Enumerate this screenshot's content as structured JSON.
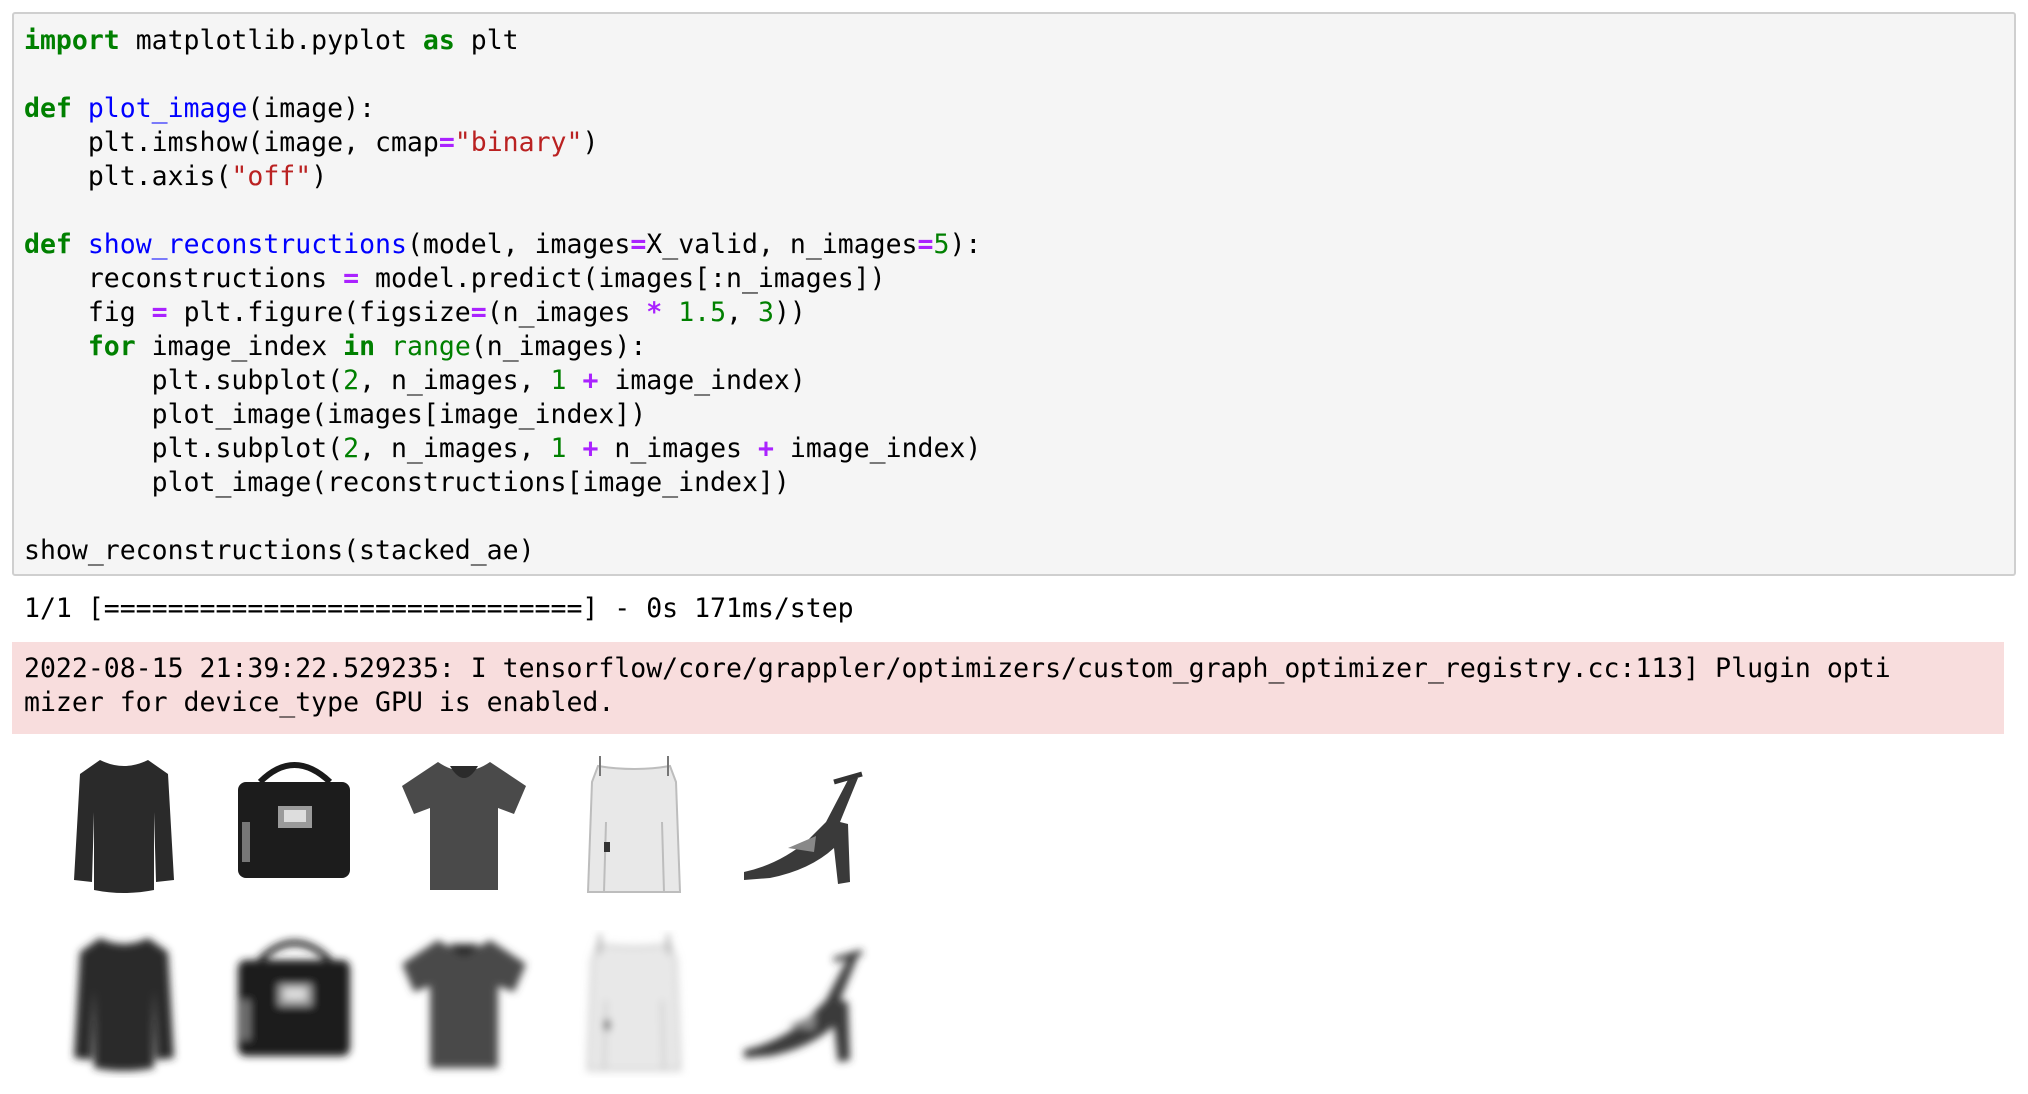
{
  "code_cell": {
    "lines": [
      [
        {
          "t": "import",
          "c": "kw"
        },
        {
          "t": " matplotlib.pyplot "
        },
        {
          "t": "as",
          "c": "kw"
        },
        {
          "t": " plt"
        }
      ],
      [],
      [
        {
          "t": "def",
          "c": "kw"
        },
        {
          "t": " "
        },
        {
          "t": "plot_image",
          "c": "fn"
        },
        {
          "t": "(image):"
        }
      ],
      [
        {
          "t": "    plt.imshow(image, cmap"
        },
        {
          "t": "=",
          "c": "op"
        },
        {
          "t": "\"binary\"",
          "c": "str"
        },
        {
          "t": ")"
        }
      ],
      [
        {
          "t": "    plt.axis("
        },
        {
          "t": "\"off\"",
          "c": "str"
        },
        {
          "t": ")"
        }
      ],
      [],
      [
        {
          "t": "def",
          "c": "kw"
        },
        {
          "t": " "
        },
        {
          "t": "show_reconstructions",
          "c": "fn"
        },
        {
          "t": "(model, images"
        },
        {
          "t": "=",
          "c": "op"
        },
        {
          "t": "X_valid, n_images"
        },
        {
          "t": "=",
          "c": "op"
        },
        {
          "t": "5",
          "c": "num"
        },
        {
          "t": "):"
        }
      ],
      [
        {
          "t": "    reconstructions "
        },
        {
          "t": "=",
          "c": "op"
        },
        {
          "t": " model.predict(images[:n_images])"
        }
      ],
      [
        {
          "t": "    fig "
        },
        {
          "t": "=",
          "c": "op"
        },
        {
          "t": " plt.figure(figsize"
        },
        {
          "t": "=",
          "c": "op"
        },
        {
          "t": "(n_images "
        },
        {
          "t": "*",
          "c": "op"
        },
        {
          "t": " "
        },
        {
          "t": "1.5",
          "c": "num"
        },
        {
          "t": ", "
        },
        {
          "t": "3",
          "c": "num"
        },
        {
          "t": "))"
        }
      ],
      [
        {
          "t": "    "
        },
        {
          "t": "for",
          "c": "kw"
        },
        {
          "t": " image_index "
        },
        {
          "t": "in",
          "c": "kw"
        },
        {
          "t": " "
        },
        {
          "t": "range",
          "c": "bi"
        },
        {
          "t": "(n_images):"
        }
      ],
      [
        {
          "t": "        plt.subplot("
        },
        {
          "t": "2",
          "c": "num"
        },
        {
          "t": ", n_images, "
        },
        {
          "t": "1",
          "c": "num"
        },
        {
          "t": " "
        },
        {
          "t": "+",
          "c": "op"
        },
        {
          "t": " image_index)"
        }
      ],
      [
        {
          "t": "        plot_image(images[image_index])"
        }
      ],
      [
        {
          "t": "        plt.subplot("
        },
        {
          "t": "2",
          "c": "num"
        },
        {
          "t": ", n_images, "
        },
        {
          "t": "1",
          "c": "num"
        },
        {
          "t": " "
        },
        {
          "t": "+",
          "c": "op"
        },
        {
          "t": " n_images "
        },
        {
          "t": "+",
          "c": "op"
        },
        {
          "t": " image_index)"
        }
      ],
      [
        {
          "t": "        plot_image(reconstructions[image_index])"
        }
      ],
      [],
      [
        {
          "t": "show_reconstructions(stacked_ae)"
        }
      ]
    ]
  },
  "output": {
    "progress_line": "1/1 [==============================] - 0s 171ms/step",
    "stderr_line1": "2022-08-15 21:39:22.529235: I tensorflow/core/grappler/optimizers/custom_graph_optimizer_registry.cc:113] Plugin opti",
    "stderr_line2": "mizer for device_type GPU is enabled."
  },
  "figure": {
    "rows": [
      [
        "long-sleeve-top",
        "bag",
        "t-shirt",
        "light-top",
        "sandal"
      ],
      [
        "long-sleeve-top-reconstruction",
        "bag-reconstruction",
        "t-shirt-reconstruction",
        "light-top-reconstruction",
        "sandal-reconstruction"
      ]
    ]
  },
  "colors": {
    "code_bg": "#f5f5f5",
    "stderr_bg": "#f8dddd",
    "keyword": "#008000",
    "function": "#0000ff",
    "string": "#ba2121",
    "operator": "#aa22ff"
  }
}
